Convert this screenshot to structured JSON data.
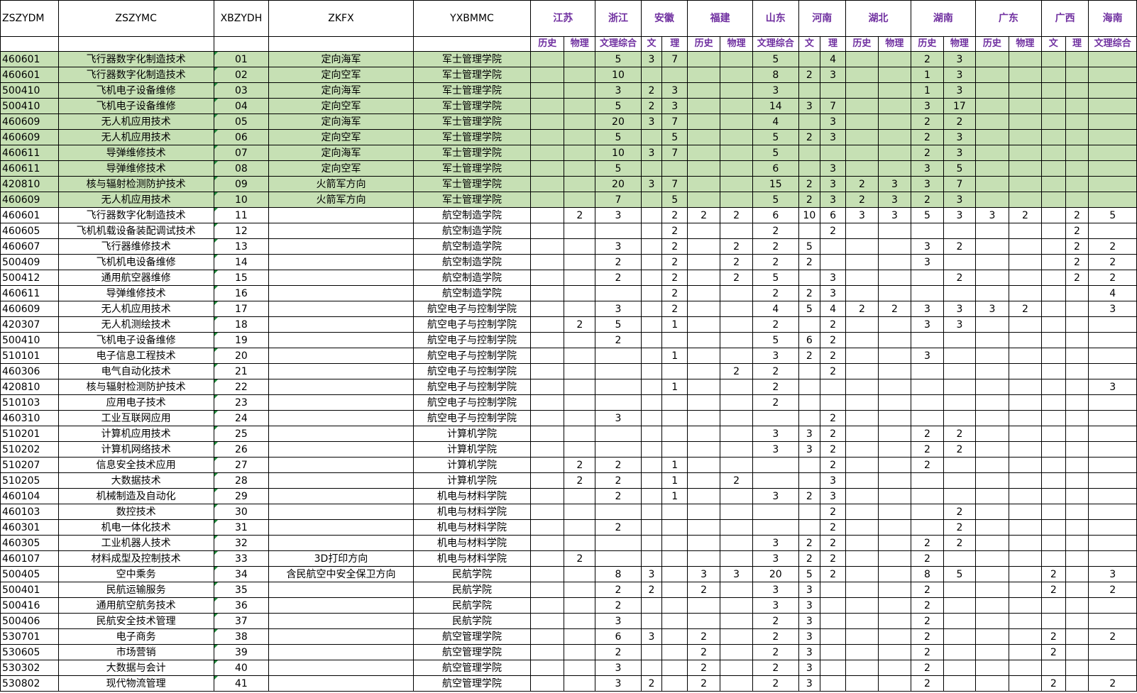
{
  "header": {
    "cols": [
      "ZSZYDM",
      "ZSZYMC",
      "XBZYDH",
      "ZKFX",
      "YXBMMC"
    ],
    "provinces": [
      {
        "name": "江苏",
        "span": 2
      },
      {
        "name": "浙江",
        "span": 1
      },
      {
        "name": "安徽",
        "span": 2
      },
      {
        "name": "福建",
        "span": 2
      },
      {
        "name": "山东",
        "span": 1
      },
      {
        "name": "河南",
        "span": 2
      },
      {
        "name": "湖北",
        "span": 2
      },
      {
        "name": "湖南",
        "span": 2
      },
      {
        "name": "广东",
        "span": 2
      },
      {
        "name": "广西",
        "span": 2
      },
      {
        "name": "海南",
        "span": 1
      }
    ],
    "subcols": [
      "历史",
      "物理",
      "文理综合",
      "文",
      "理",
      "历史",
      "物理",
      "文理综合",
      "文",
      "理",
      "历史",
      "物理",
      "历史",
      "物理",
      "历史",
      "物理",
      "文",
      "理",
      "文理综合"
    ]
  },
  "rows": [
    {
      "h": true,
      "c": [
        "460601",
        "飞行器数字化制造技术",
        "01",
        "定向海军",
        "军士管理学院",
        "",
        "",
        "5",
        "3",
        "7",
        "",
        "",
        "5",
        "",
        "4",
        "",
        "",
        "2",
        "3",
        "",
        "",
        "",
        "",
        ""
      ]
    },
    {
      "h": true,
      "c": [
        "460601",
        "飞行器数字化制造技术",
        "02",
        "定向空军",
        "军士管理学院",
        "",
        "",
        "10",
        "",
        "",
        "",
        "",
        "8",
        "2",
        "3",
        "",
        "",
        "1",
        "3",
        "",
        "",
        "",
        "",
        ""
      ]
    },
    {
      "h": true,
      "c": [
        "500410",
        "飞机电子设备维修",
        "03",
        "定向海军",
        "军士管理学院",
        "",
        "",
        "3",
        "2",
        "3",
        "",
        "",
        "3",
        "",
        "",
        "",
        "",
        "1",
        "3",
        "",
        "",
        "",
        "",
        ""
      ]
    },
    {
      "h": true,
      "c": [
        "500410",
        "飞机电子设备维修",
        "04",
        "定向空军",
        "军士管理学院",
        "",
        "",
        "5",
        "2",
        "3",
        "",
        "",
        "14",
        "3",
        "7",
        "",
        "",
        "3",
        "17",
        "",
        "",
        "",
        "",
        ""
      ]
    },
    {
      "h": true,
      "c": [
        "460609",
        "无人机应用技术",
        "05",
        "定向海军",
        "军士管理学院",
        "",
        "",
        "20",
        "3",
        "7",
        "",
        "",
        "4",
        "",
        "3",
        "",
        "",
        "2",
        "2",
        "",
        "",
        "",
        "",
        ""
      ]
    },
    {
      "h": true,
      "c": [
        "460609",
        "无人机应用技术",
        "06",
        "定向空军",
        "军士管理学院",
        "",
        "",
        "5",
        "",
        "5",
        "",
        "",
        "5",
        "2",
        "3",
        "",
        "",
        "2",
        "3",
        "",
        "",
        "",
        "",
        ""
      ]
    },
    {
      "h": true,
      "c": [
        "460611",
        "导弹维修技术",
        "07",
        "定向海军",
        "军士管理学院",
        "",
        "",
        "10",
        "3",
        "7",
        "",
        "",
        "5",
        "",
        "",
        "",
        "",
        "2",
        "3",
        "",
        "",
        "",
        "",
        ""
      ]
    },
    {
      "h": true,
      "c": [
        "460611",
        "导弹维修技术",
        "08",
        "定向空军",
        "军士管理学院",
        "",
        "",
        "5",
        "",
        "",
        "",
        "",
        "6",
        "",
        "3",
        "",
        "",
        "3",
        "5",
        "",
        "",
        "",
        "",
        ""
      ]
    },
    {
      "h": true,
      "c": [
        "420810",
        "核与辐射检测防护技术",
        "09",
        "火箭军方向",
        "军士管理学院",
        "",
        "",
        "20",
        "3",
        "7",
        "",
        "",
        "15",
        "2",
        "3",
        "2",
        "3",
        "3",
        "7",
        "",
        "",
        "",
        "",
        ""
      ]
    },
    {
      "h": true,
      "c": [
        "460609",
        "无人机应用技术",
        "10",
        "火箭军方向",
        "军士管理学院",
        "",
        "",
        "7",
        "",
        "5",
        "",
        "",
        "5",
        "2",
        "3",
        "2",
        "3",
        "2",
        "3",
        "",
        "",
        "",
        "",
        ""
      ]
    },
    {
      "h": false,
      "c": [
        "460601",
        "飞行器数字化制造技术",
        "11",
        "",
        "航空制造学院",
        "",
        "2",
        "3",
        "",
        "2",
        "2",
        "2",
        "6",
        "10",
        "6",
        "3",
        "3",
        "5",
        "3",
        "3",
        "2",
        "",
        "2",
        "5"
      ]
    },
    {
      "h": false,
      "c": [
        "460605",
        "飞机机载设备装配调试技术",
        "12",
        "",
        "航空制造学院",
        "",
        "",
        "",
        "",
        "2",
        "",
        "",
        "2",
        "",
        "2",
        "",
        "",
        "",
        "",
        "",
        "",
        "",
        "2",
        ""
      ]
    },
    {
      "h": false,
      "c": [
        "460607",
        "飞行器维修技术",
        "13",
        "",
        "航空制造学院",
        "",
        "",
        "3",
        "",
        "2",
        "",
        "2",
        "2",
        "5",
        "",
        "",
        "",
        "3",
        "2",
        "",
        "",
        "",
        "2",
        "2"
      ]
    },
    {
      "h": false,
      "c": [
        "500409",
        "飞机机电设备维修",
        "14",
        "",
        "航空制造学院",
        "",
        "",
        "2",
        "",
        "2",
        "",
        "2",
        "2",
        "2",
        "",
        "",
        "",
        "3",
        "",
        "",
        "",
        "",
        "2",
        "2"
      ]
    },
    {
      "h": false,
      "c": [
        "500412",
        "通用航空器维修",
        "15",
        "",
        "航空制造学院",
        "",
        "",
        "2",
        "",
        "2",
        "",
        "2",
        "5",
        "",
        "3",
        "",
        "",
        "",
        "2",
        "",
        "",
        "",
        "2",
        "2"
      ]
    },
    {
      "h": false,
      "c": [
        "460611",
        "导弹维修技术",
        "16",
        "",
        "航空制造学院",
        "",
        "",
        "",
        "",
        "2",
        "",
        "",
        "2",
        "2",
        "3",
        "",
        "",
        "",
        "",
        "",
        "",
        "",
        "",
        "4"
      ]
    },
    {
      "h": false,
      "c": [
        "460609",
        "无人机应用技术",
        "17",
        "",
        "航空电子与控制学院",
        "",
        "",
        "3",
        "",
        "2",
        "",
        "",
        "4",
        "5",
        "4",
        "2",
        "2",
        "3",
        "3",
        "3",
        "2",
        "",
        "",
        "3"
      ]
    },
    {
      "h": false,
      "c": [
        "420307",
        "无人机测绘技术",
        "18",
        "",
        "航空电子与控制学院",
        "",
        "2",
        "5",
        "",
        "1",
        "",
        "",
        "2",
        "",
        "2",
        "",
        "",
        "3",
        "3",
        "",
        "",
        "",
        "",
        ""
      ]
    },
    {
      "h": false,
      "c": [
        "500410",
        "飞机电子设备维修",
        "19",
        "",
        "航空电子与控制学院",
        "",
        "",
        "2",
        "",
        "",
        "",
        "",
        "5",
        "6",
        "2",
        "",
        "",
        "",
        "",
        "",
        "",
        "",
        "",
        ""
      ]
    },
    {
      "h": false,
      "c": [
        "510101",
        "电子信息工程技术",
        "20",
        "",
        "航空电子与控制学院",
        "",
        "",
        "",
        "",
        "1",
        "",
        "",
        "3",
        "2",
        "2",
        "",
        "",
        "3",
        "",
        "",
        "",
        "",
        "",
        ""
      ]
    },
    {
      "h": false,
      "c": [
        "460306",
        "电气自动化技术",
        "21",
        "",
        "航空电子与控制学院",
        "",
        "",
        "",
        "",
        "",
        "",
        "2",
        "2",
        "",
        "2",
        "",
        "",
        "",
        "",
        "",
        "",
        "",
        "",
        ""
      ]
    },
    {
      "h": false,
      "c": [
        "420810",
        "核与辐射检测防护技术",
        "22",
        "",
        "航空电子与控制学院",
        "",
        "",
        "",
        "",
        "1",
        "",
        "",
        "2",
        "",
        "",
        "",
        "",
        "",
        "",
        "",
        "",
        "",
        "",
        "3"
      ]
    },
    {
      "h": false,
      "c": [
        "510103",
        "应用电子技术",
        "23",
        "",
        "航空电子与控制学院",
        "",
        "",
        "",
        "",
        "",
        "",
        "",
        "2",
        "",
        "",
        "",
        "",
        "",
        "",
        "",
        "",
        "",
        "",
        ""
      ]
    },
    {
      "h": false,
      "c": [
        "460310",
        "工业互联网应用",
        "24",
        "",
        "航空电子与控制学院",
        "",
        "",
        "3",
        "",
        "",
        "",
        "",
        "",
        "",
        "2",
        "",
        "",
        "",
        "",
        "",
        "",
        "",
        "",
        ""
      ]
    },
    {
      "h": false,
      "c": [
        "510201",
        "计算机应用技术",
        "25",
        "",
        "计算机学院",
        "",
        "",
        "",
        "",
        "",
        "",
        "",
        "3",
        "3",
        "2",
        "",
        "",
        "2",
        "2",
        "",
        "",
        "",
        "",
        ""
      ]
    },
    {
      "h": false,
      "c": [
        "510202",
        "计算机网络技术",
        "26",
        "",
        "计算机学院",
        "",
        "",
        "",
        "",
        "",
        "",
        "",
        "3",
        "3",
        "2",
        "",
        "",
        "2",
        "2",
        "",
        "",
        "",
        "",
        ""
      ]
    },
    {
      "h": false,
      "c": [
        "510207",
        "信息安全技术应用",
        "27",
        "",
        "计算机学院",
        "",
        "2",
        "2",
        "",
        "1",
        "",
        "",
        "",
        "",
        "2",
        "",
        "",
        "2",
        "",
        "",
        "",
        "",
        "",
        ""
      ]
    },
    {
      "h": false,
      "c": [
        "510205",
        "大数据技术",
        "28",
        "",
        "计算机学院",
        "",
        "2",
        "2",
        "",
        "1",
        "",
        "2",
        "",
        "",
        "3",
        "",
        "",
        "",
        "",
        "",
        "",
        "",
        "",
        ""
      ]
    },
    {
      "h": false,
      "c": [
        "460104",
        "机械制造及自动化",
        "29",
        "",
        "机电与材料学院",
        "",
        "",
        "2",
        "",
        "1",
        "",
        "",
        "3",
        "2",
        "3",
        "",
        "",
        "",
        "",
        "",
        "",
        "",
        "",
        ""
      ]
    },
    {
      "h": false,
      "c": [
        "460103",
        "数控技术",
        "30",
        "",
        "机电与材料学院",
        "",
        "",
        "",
        "",
        "",
        "",
        "",
        "",
        "",
        "2",
        "",
        "",
        "",
        "2",
        "",
        "",
        "",
        "",
        ""
      ]
    },
    {
      "h": false,
      "c": [
        "460301",
        "机电一体化技术",
        "31",
        "",
        "机电与材料学院",
        "",
        "",
        "2",
        "",
        "",
        "",
        "",
        "",
        "",
        "2",
        "",
        "",
        "",
        "2",
        "",
        "",
        "",
        "",
        ""
      ]
    },
    {
      "h": false,
      "c": [
        "460305",
        "工业机器人技术",
        "32",
        "",
        "机电与材料学院",
        "",
        "",
        "",
        "",
        "",
        "",
        "",
        "3",
        "2",
        "2",
        "",
        "",
        "2",
        "2",
        "",
        "",
        "",
        "",
        ""
      ]
    },
    {
      "h": false,
      "c": [
        "460107",
        "材料成型及控制技术",
        "33",
        "3D打印方向",
        "机电与材料学院",
        "",
        "2",
        "",
        "",
        "",
        "",
        "",
        "3",
        "2",
        "2",
        "",
        "",
        "2",
        "",
        "",
        "",
        "",
        "",
        ""
      ]
    },
    {
      "h": false,
      "c": [
        "500405",
        "空中乘务",
        "34",
        "含民航空中安全保卫方向",
        "民航学院",
        "",
        "",
        "8",
        "3",
        "",
        "3",
        "3",
        "20",
        "5",
        "2",
        "",
        "",
        "8",
        "5",
        "",
        "",
        "2",
        "",
        "3"
      ]
    },
    {
      "h": false,
      "c": [
        "500401",
        "民航运输服务",
        "35",
        "",
        "民航学院",
        "",
        "",
        "2",
        "2",
        "",
        "2",
        "",
        "3",
        "3",
        "",
        "",
        "",
        "2",
        "",
        "",
        "",
        "2",
        "",
        "2"
      ]
    },
    {
      "h": false,
      "c": [
        "500416",
        "通用航空航务技术",
        "36",
        "",
        "民航学院",
        "",
        "",
        "2",
        "",
        "",
        "",
        "",
        "3",
        "3",
        "",
        "",
        "",
        "2",
        "",
        "",
        "",
        "",
        "",
        ""
      ]
    },
    {
      "h": false,
      "c": [
        "500406",
        "民航安全技术管理",
        "37",
        "",
        "民航学院",
        "",
        "",
        "3",
        "",
        "",
        "",
        "",
        "2",
        "3",
        "",
        "",
        "",
        "2",
        "",
        "",
        "",
        "",
        "",
        ""
      ]
    },
    {
      "h": false,
      "c": [
        "530701",
        "电子商务",
        "38",
        "",
        "航空管理学院",
        "",
        "",
        "6",
        "3",
        "",
        "2",
        "",
        "2",
        "3",
        "",
        "",
        "",
        "2",
        "",
        "",
        "",
        "2",
        "",
        "2"
      ]
    },
    {
      "h": false,
      "c": [
        "530605",
        "市场营销",
        "39",
        "",
        "航空管理学院",
        "",
        "",
        "2",
        "",
        "",
        "2",
        "",
        "2",
        "3",
        "",
        "",
        "",
        "2",
        "",
        "",
        "",
        "2",
        "",
        ""
      ]
    },
    {
      "h": false,
      "c": [
        "530302",
        "大数据与会计",
        "40",
        "",
        "航空管理学院",
        "",
        "",
        "3",
        "",
        "",
        "2",
        "",
        "2",
        "3",
        "",
        "",
        "",
        "2",
        "",
        "",
        "",
        "",
        "",
        ""
      ]
    },
    {
      "h": false,
      "c": [
        "530802",
        "现代物流管理",
        "41",
        "",
        "航空管理学院",
        "",
        "",
        "3",
        "2",
        "",
        "2",
        "",
        "2",
        "3",
        "",
        "",
        "",
        "2",
        "",
        "",
        "",
        "2",
        "",
        "2"
      ]
    }
  ]
}
